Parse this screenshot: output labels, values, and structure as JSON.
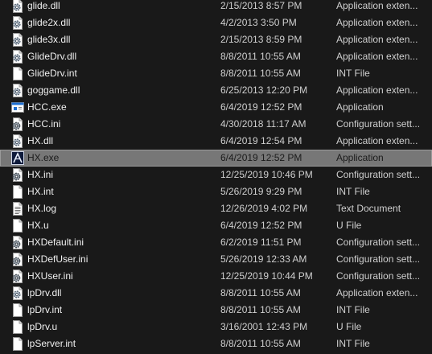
{
  "files": [
    {
      "name": "glide.dll",
      "date": "2/15/2013 8:57 PM",
      "type": "Application exten...",
      "icon": "dll-gear-icon"
    },
    {
      "name": "glide2x.dll",
      "date": "4/2/2013 3:50 PM",
      "type": "Application exten...",
      "icon": "dll-gear-icon"
    },
    {
      "name": "glide3x.dll",
      "date": "2/15/2013 8:59 PM",
      "type": "Application exten...",
      "icon": "dll-gear-icon"
    },
    {
      "name": "GlideDrv.dll",
      "date": "8/8/2011 10:55 AM",
      "type": "Application exten...",
      "icon": "dll-gear-icon"
    },
    {
      "name": "GlideDrv.int",
      "date": "8/8/2011 10:55 AM",
      "type": "INT File",
      "icon": "blank-file-icon"
    },
    {
      "name": "goggame.dll",
      "date": "6/25/2013 12:20 PM",
      "type": "Application exten...",
      "icon": "dll-gear-icon"
    },
    {
      "name": "HCC.exe",
      "date": "6/4/2019 12:52 PM",
      "type": "Application",
      "icon": "application-window-icon"
    },
    {
      "name": "HCC.ini",
      "date": "4/30/2018 11:17 AM",
      "type": "Configuration sett...",
      "icon": "config-gear-icon"
    },
    {
      "name": "HX.dll",
      "date": "6/4/2019 12:54 PM",
      "type": "Application exten...",
      "icon": "dll-gear-icon"
    },
    {
      "name": "HX.exe",
      "date": "6/4/2019 12:52 PM",
      "type": "Application",
      "icon": "deus-ex-app-icon",
      "selected": true
    },
    {
      "name": "HX.ini",
      "date": "12/25/2019 10:46 PM",
      "type": "Configuration sett...",
      "icon": "config-gear-icon"
    },
    {
      "name": "HX.int",
      "date": "5/26/2019 9:29 PM",
      "type": "INT File",
      "icon": "blank-file-icon"
    },
    {
      "name": "HX.log",
      "date": "12/26/2019 4:02 PM",
      "type": "Text Document",
      "icon": "text-document-icon"
    },
    {
      "name": "HX.u",
      "date": "6/4/2019 12:52 PM",
      "type": "U File",
      "icon": "blank-file-icon"
    },
    {
      "name": "HXDefault.ini",
      "date": "6/2/2019 11:51 PM",
      "type": "Configuration sett...",
      "icon": "config-gear-icon"
    },
    {
      "name": "HXDefUser.ini",
      "date": "5/26/2019 12:33 AM",
      "type": "Configuration sett...",
      "icon": "config-gear-icon"
    },
    {
      "name": "HXUser.ini",
      "date": "12/25/2019 10:44 PM",
      "type": "Configuration sett...",
      "icon": "config-gear-icon"
    },
    {
      "name": "lpDrv.dll",
      "date": "8/8/2011 10:55 AM",
      "type": "Application exten...",
      "icon": "dll-gear-icon"
    },
    {
      "name": "lpDrv.int",
      "date": "8/8/2011 10:55 AM",
      "type": "INT File",
      "icon": "blank-file-icon"
    },
    {
      "name": "lpDrv.u",
      "date": "3/16/2001 12:43 PM",
      "type": "U File",
      "icon": "blank-file-icon"
    },
    {
      "name": "lpServer.int",
      "date": "8/8/2011 10:55 AM",
      "type": "INT File",
      "icon": "blank-file-icon"
    }
  ],
  "colors": {
    "background": "#191919",
    "selected_row": "#777777",
    "text": "#e6e6e6",
    "app_icon_blue": "#1f6fd1"
  }
}
